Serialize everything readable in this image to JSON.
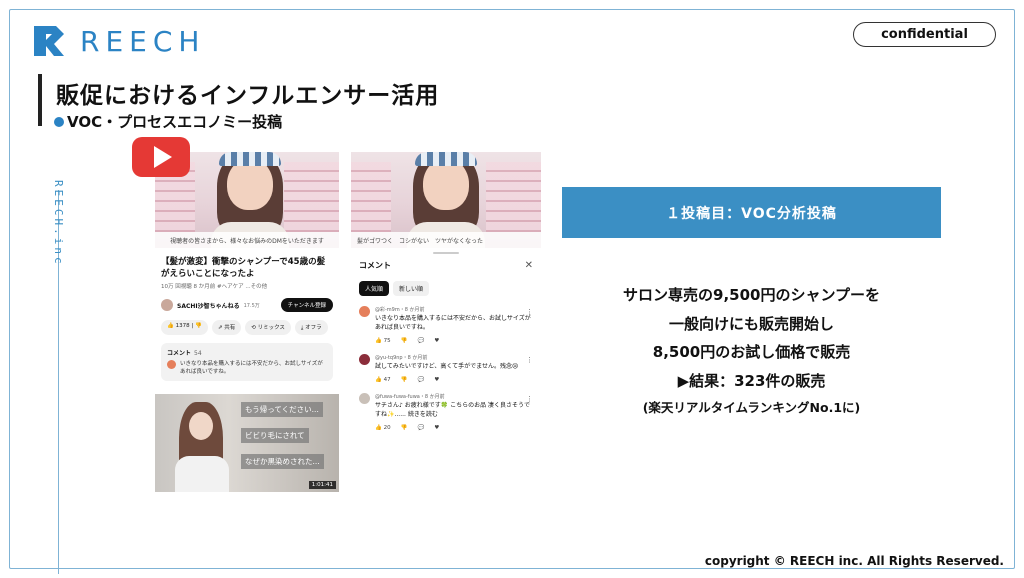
{
  "brand": {
    "name": "REECH",
    "vertical": "REECH.inc",
    "accent": "#2b83c4"
  },
  "badge": "confidential",
  "title": "販促におけるインフルエンサー活用",
  "subtitle": "VOC・プロセスエコノミー投稿",
  "phone1": {
    "video_caption": "視聴者の皆さまから、様々なお悩みのDMをいただきます",
    "video_title": "【髪が激変】衝撃のシャンプーで45歳の髪がえらいことになったよ",
    "meta": "10万 回視聴  8 か月前  #ヘアケア  ...その他",
    "channel": "SACHI沙智ちゃんねる",
    "subs": "17.5万",
    "subscribe": "チャンネル登録",
    "actions": [
      "1378",
      "共有",
      "リミックス",
      "オフラ"
    ],
    "comments_label": "コメント",
    "comments_count": "54",
    "top_comment": "いきなり本品を購入するには不安だから、お試しサイズがあれば良いですね。",
    "overlays": [
      "もう帰ってください...",
      "ビビり毛にされて",
      "なぜか黒染めされた..."
    ],
    "duration": "1:01:41"
  },
  "phone2": {
    "video_caption": "髪がゴワつく　コシがない　ツヤがなくなった",
    "sheet_title": "コメント",
    "chips": [
      "人気順",
      "新しい順"
    ],
    "comments": [
      {
        "user": "@彩-m9m・8 か月前",
        "text": "いきなり本品を購入するには不安だから、お試しサイズがあれば良いですね。",
        "likes": "75",
        "color": "#e57f5b"
      },
      {
        "user": "@yu-tq9np・8 か月前",
        "text": "試してみたいですけど、高くて手がでません。残念😢",
        "likes": "47",
        "color": "#8b2d3a"
      },
      {
        "user": "@fuwa-fuwa-fuwa・8 か月前",
        "text": "サチさん♪ お疲れ様です🍀 こちらのお品 凄く良さそうですね✨...... 続きを読む",
        "likes": "20",
        "color": "#c9c0b8"
      }
    ]
  },
  "panel": {
    "heading": "１投稿目：VOC分析投稿",
    "lines": [
      "サロン専売の9,500円のシャンプーを",
      "一般向けにも販売開始し",
      "8,500円のお試し価格で販売",
      "▶結果：323件の販売"
    ],
    "note": "(楽天リアルタイムランキングNo.1に)"
  },
  "copyright": "copyright © REECH inc. All Rights Reserved."
}
